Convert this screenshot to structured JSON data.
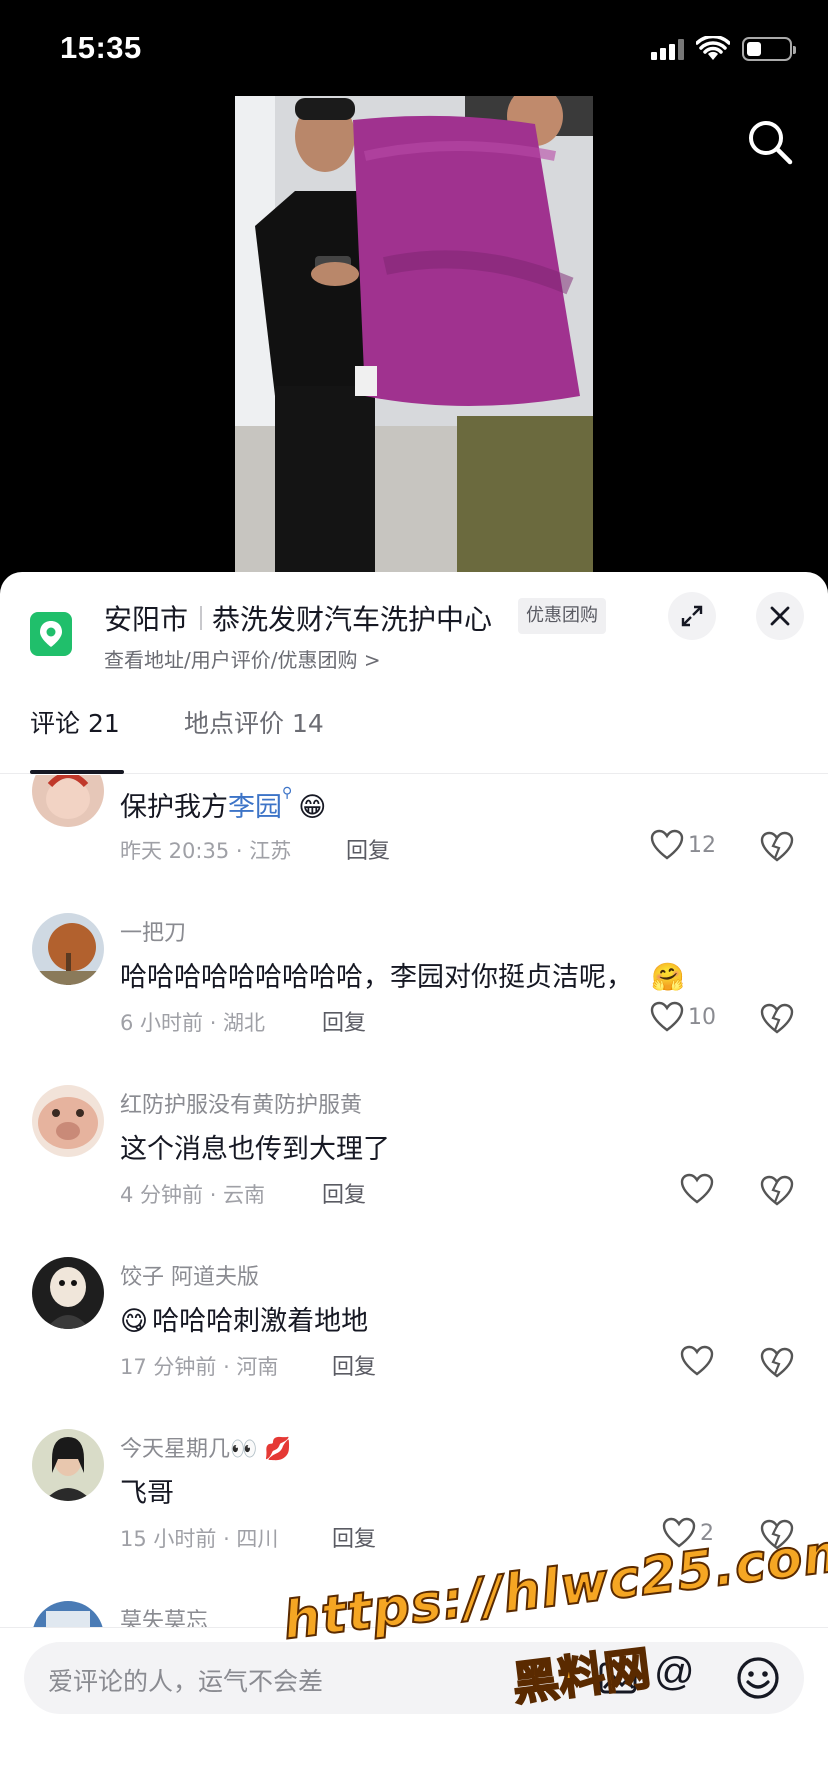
{
  "status": {
    "time": "15:35"
  },
  "location": {
    "city": "安阳市",
    "place": "恭洗发财汽车洗护中心",
    "tag": "优惠团购",
    "links": "查看地址/用户评价/优惠团购 >"
  },
  "tabs": [
    {
      "label": "评论 21",
      "active": true
    },
    {
      "label": "地点评价 14",
      "active": false
    }
  ],
  "comments": [
    {
      "username": "",
      "content_before": "保护我方",
      "mention": "李园",
      "emoji": "😁",
      "time": "昨天 20:35",
      "region": "江苏",
      "meta": "昨天 20:35 · 江苏",
      "reply": "回复",
      "likes": "12"
    },
    {
      "username": "一把刀",
      "content": "哈哈哈哈哈哈哈哈哈，李园对你挺贞洁呢，",
      "emoji": "🤗",
      "meta": "6 小时前 · 湖北",
      "reply": "回复",
      "likes": "10"
    },
    {
      "username": "红防护服没有黄防护服黄",
      "content": "这个消息也传到大理了",
      "meta": "4 分钟前 · 云南",
      "reply": "回复",
      "likes": ""
    },
    {
      "username": "饺子 阿道夫版",
      "emoji": "😋",
      "content": "哈哈哈刺激着地地",
      "meta": "17 分钟前 · 河南",
      "reply": "回复",
      "likes": ""
    },
    {
      "username": "今天星期几👀 💋",
      "content": "飞哥",
      "meta": "15 小时前 · 四川",
      "reply": "回复",
      "likes": "2"
    },
    {
      "username": "莫失莫忘",
      "content": "",
      "meta": "",
      "reply": "",
      "likes": ""
    }
  ],
  "input": {
    "placeholder": "爱评论的人，运气不会差"
  },
  "watermark": {
    "url": "https://hlwc25.com",
    "name": "黑料网"
  },
  "colors": {
    "accent_green": "#20bf6b",
    "mention_blue": "#3d74c7",
    "watermark_orange": "#f5a623"
  },
  "icons": [
    "search-icon",
    "location-pin-icon",
    "expand-icon",
    "close-icon",
    "heart-icon",
    "broken-heart-icon",
    "image-icon",
    "at-icon",
    "emoji-icon"
  ]
}
